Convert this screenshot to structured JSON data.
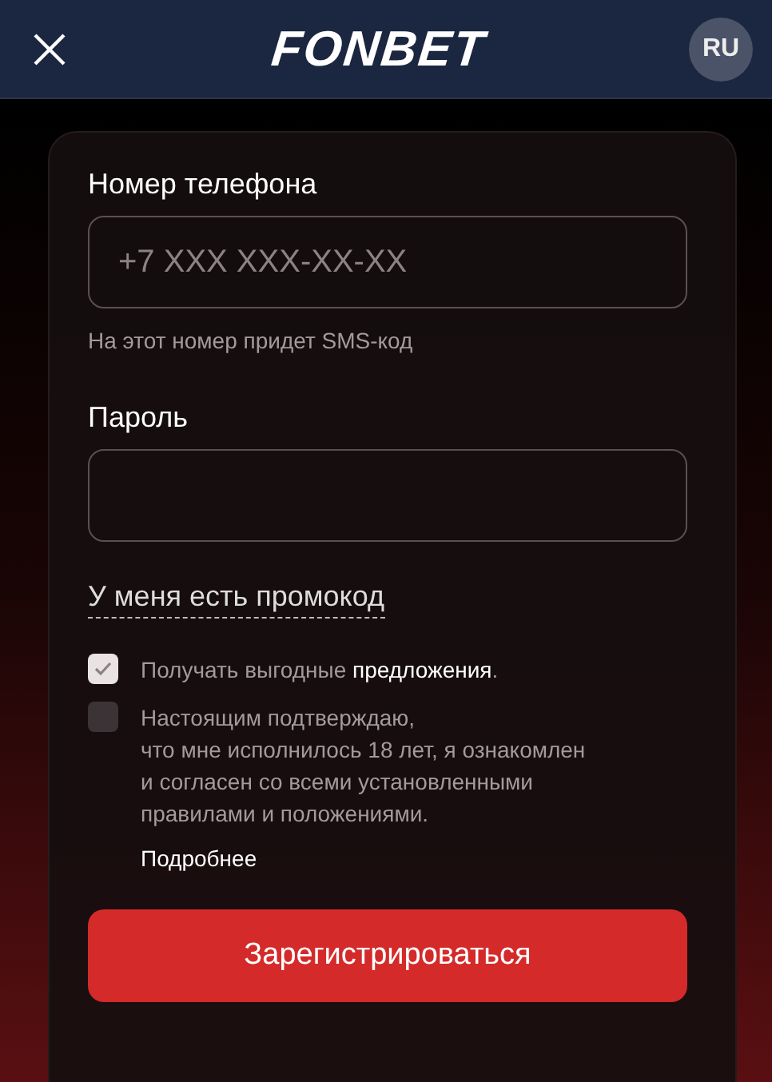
{
  "header": {
    "logo": "FONBET",
    "language": "RU"
  },
  "phone": {
    "label": "Номер телефона",
    "placeholder": "+7 XXX XXX-XX-XX",
    "hint": "На этот номер придет SMS-код"
  },
  "password": {
    "label": "Пароль"
  },
  "promo_link": "У меня есть промокод",
  "consents": [
    {
      "text": "Получать выгодные **предложения**.",
      "checked": true
    },
    {
      "text": "Настоящим подтверждаю,\nчто мне исполнилось 18 лет, я ознакомлен\nи согласен со всеми установленными\nправилами и положениями.",
      "checked": false,
      "link": "Подробнее"
    }
  ],
  "submit": "Зарегистрироваться"
}
